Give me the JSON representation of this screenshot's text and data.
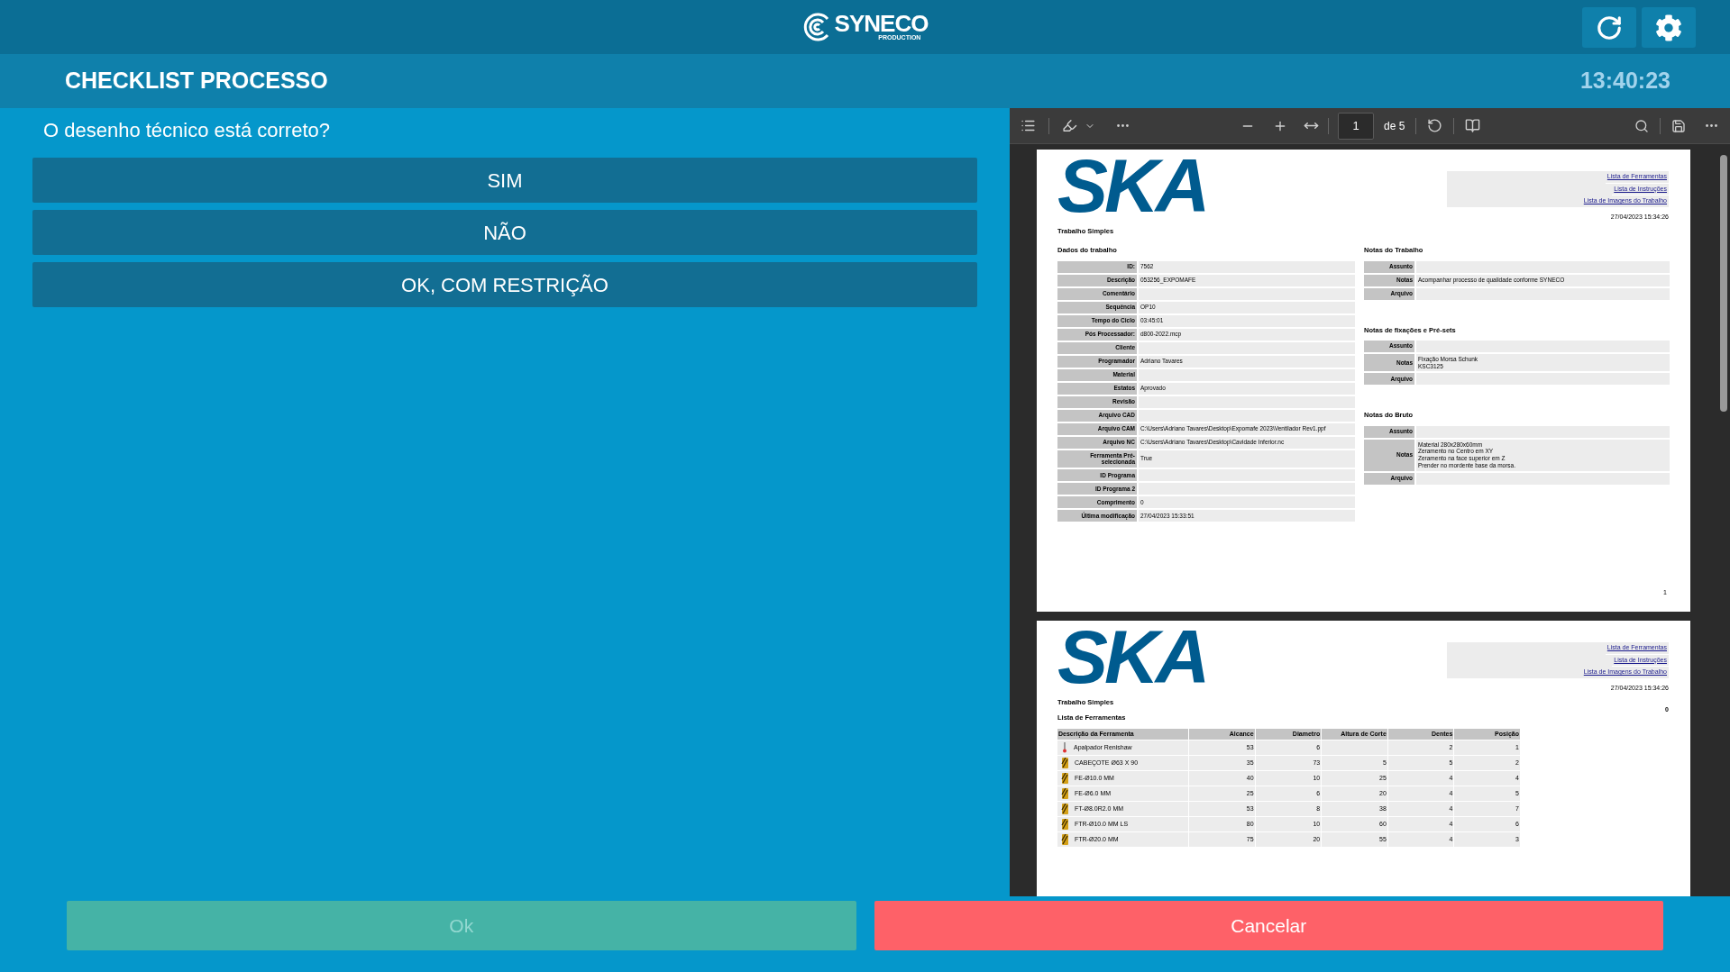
{
  "top_bar": {
    "logo_name": "SYNECO",
    "logo_sub": "PRODUCTION"
  },
  "header": {
    "title": "CHECKLIST PROCESSO",
    "clock": "13:40:23"
  },
  "question": "O desenho técnico está correto?",
  "options": [
    {
      "label": "SIM"
    },
    {
      "label": "NÃO"
    },
    {
      "label": "OK, COM RESTRIÇÃO"
    }
  ],
  "pdf_viewer": {
    "page_input": "1",
    "page_count": "de 5",
    "pages": [
      {
        "logo": "SKA",
        "subtitle": "Trabalho Simples",
        "links": [
          "Lista de Ferramentas",
          "Lista de Instruções",
          "Lista de Imagens do Trabalho"
        ],
        "date": "27/04/2023 15:34:26",
        "left_sections": [
          {
            "title": "Dados do trabalho",
            "rows": [
              [
                "ID:",
                "7562"
              ],
              [
                "Descrição",
                "053256_EXPOMAFE"
              ],
              [
                "Comentário",
                ""
              ],
              [
                "Sequência",
                "OP10"
              ],
              [
                "Tempo do Ciclo",
                "03:45:01"
              ],
              [
                "Pós Processador:",
                "d800-2022.mcp"
              ],
              [
                "Cliente",
                ""
              ],
              [
                "Programador",
                "Adriano Tavares"
              ],
              [
                "Material",
                ""
              ],
              [
                "Estatos",
                "Aprovado"
              ],
              [
                "Revisão",
                ""
              ],
              [
                "Arquivo CAD",
                ""
              ],
              [
                "Arquivo CAM",
                "C:\\Users\\Adriano Tavares\\Desktop\\Expomafe 2023\\Ventilador Rev1.ppf"
              ],
              [
                "Arquivo NC",
                "C:\\Users\\Adriano Tavares\\Desktop\\Cavidade Inferior.nc"
              ],
              [
                "Ferramenta Pré-selecionada",
                "True"
              ],
              [
                "ID Programa",
                ""
              ],
              [
                "ID Programa 2",
                ""
              ],
              [
                "Comprimento",
                "0"
              ],
              [
                "Última modificação",
                "27/04/2023 15:33:51"
              ]
            ]
          }
        ],
        "right_sections": [
          {
            "title": "Notas do Trabalho",
            "rows": [
              [
                "Assunto",
                ""
              ],
              [
                "Notas",
                "Acompanhar processo de qualidade conforme SYNECO"
              ],
              [
                "Arquivo",
                ""
              ]
            ]
          },
          {
            "title": "Notas de fixações e Pré-sets",
            "rows": [
              [
                "Assunto",
                ""
              ],
              [
                "Notas",
                "Fixação Morsa Schunk\nKSC3125"
              ],
              [
                "Arquivo",
                ""
              ]
            ]
          },
          {
            "title": "Notas do Bruto",
            "rows": [
              [
                "Assunto",
                ""
              ],
              [
                "Notas",
                "Material 280x280x60mm\nZeramento no Centro em XY\nZeramento na face superior em Z\nPrender no mordente base da morsa."
              ],
              [
                "Arquivo",
                ""
              ]
            ]
          }
        ],
        "page_number": "1"
      },
      {
        "logo": "SKA",
        "subtitle": "Trabalho Simples",
        "heading": "Lista de Ferramentas",
        "links": [
          "Lista de Ferramentas",
          "Lista de Instruções",
          "Lista de Imagens do Trabalho"
        ],
        "date": "27/04/2023 15:34:26",
        "count": "0",
        "tool_table": {
          "columns": [
            "Descrição da Ferramenta",
            "Alcance",
            "Diametro",
            "Altura de Corte",
            "Dentes",
            "Posição"
          ],
          "rows": [
            {
              "kind": "probe",
              "cells": [
                "Apalpador Renishaw",
                "53",
                "6",
                "",
                "2",
                "1"
              ]
            },
            {
              "kind": "mill",
              "cells": [
                "CABEÇOTE Ø63 X 90",
                "35",
                "73",
                "5",
                "5",
                "2"
              ]
            },
            {
              "kind": "mill",
              "cells": [
                "FE-Ø10.0 MM",
                "40",
                "10",
                "25",
                "4",
                "4"
              ]
            },
            {
              "kind": "mill",
              "cells": [
                "FE-Ø6.0 MM",
                "25",
                "6",
                "20",
                "4",
                "5"
              ]
            },
            {
              "kind": "mill",
              "cells": [
                "FT-Ø8.0R2.0 MM",
                "53",
                "8",
                "38",
                "4",
                "7"
              ]
            },
            {
              "kind": "mill",
              "cells": [
                "FTR-Ø10.0 MM LS",
                "80",
                "10",
                "60",
                "4",
                "6"
              ]
            },
            {
              "kind": "mill",
              "cells": [
                "FTR-Ø20.0 MM",
                "75",
                "20",
                "55",
                "4",
                "3"
              ]
            }
          ]
        }
      }
    ]
  },
  "footer_buttons": [
    {
      "label": "Ok",
      "kind": "confirm",
      "disabled": true
    },
    {
      "label": "Cancelar",
      "kind": "cancel",
      "disabled": false
    }
  ]
}
